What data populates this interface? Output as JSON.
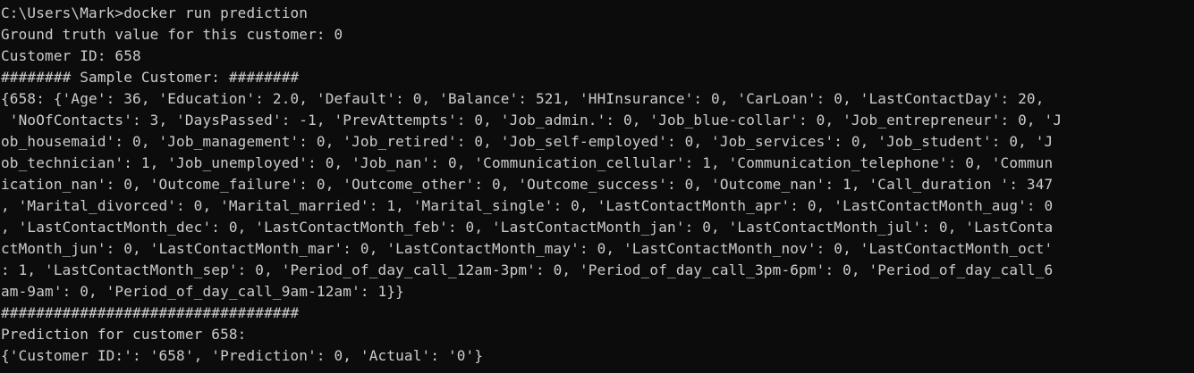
{
  "terminal": {
    "colors": {
      "background": "#0c0c0c",
      "foreground": "#cccccc"
    },
    "prompt": "C:\\Users\\Mark>",
    "command": "docker run prediction",
    "ground_truth": "Ground truth value for this customer: 0",
    "customer_id": "Customer ID: 658",
    "sample_header": "######## Sample Customer: ########",
    "sample_lines": [
      "{658: {'Age': 36, 'Education': 2.0, 'Default': 0, 'Balance': 521, 'HHInsurance': 0, 'CarLoan': 0, 'LastContactDay': 20,",
      " 'NoOfContacts': 3, 'DaysPassed': -1, 'PrevAttempts': 0, 'Job_admin.': 0, 'Job_blue-collar': 0, 'Job_entrepreneur': 0, 'J",
      "ob_housemaid': 0, 'Job_management': 0, 'Job_retired': 0, 'Job_self-employed': 0, 'Job_services': 0, 'Job_student': 0, 'J",
      "ob_technician': 1, 'Job_unemployed': 0, 'Job_nan': 0, 'Communication_cellular': 1, 'Communication_telephone': 0, 'Commun",
      "ication_nan': 0, 'Outcome_failure': 0, 'Outcome_other': 0, 'Outcome_success': 0, 'Outcome_nan': 1, 'Call_duration ': 347",
      ", 'Marital_divorced': 0, 'Marital_married': 1, 'Marital_single': 0, 'LastContactMonth_apr': 0, 'LastContactMonth_aug': 0",
      ", 'LastContactMonth_dec': 0, 'LastContactMonth_feb': 0, 'LastContactMonth_jan': 0, 'LastContactMonth_jul': 0, 'LastConta",
      "ctMonth_jun': 0, 'LastContactMonth_mar': 0, 'LastContactMonth_may': 0, 'LastContactMonth_nov': 0, 'LastContactMonth_oct'",
      ": 1, 'LastContactMonth_sep': 0, 'Period_of_day_call_12am-3pm': 0, 'Period_of_day_call_3pm-6pm': 0, 'Period_of_day_call_6",
      "am-9am': 0, 'Period_of_day_call_9am-12am': 1}}"
    ],
    "sample_footer": "##################################",
    "prediction_header": "Prediction for customer 658:",
    "prediction_result": "{'Customer ID:': '658', 'Prediction': 0, 'Actual': '0'}"
  }
}
